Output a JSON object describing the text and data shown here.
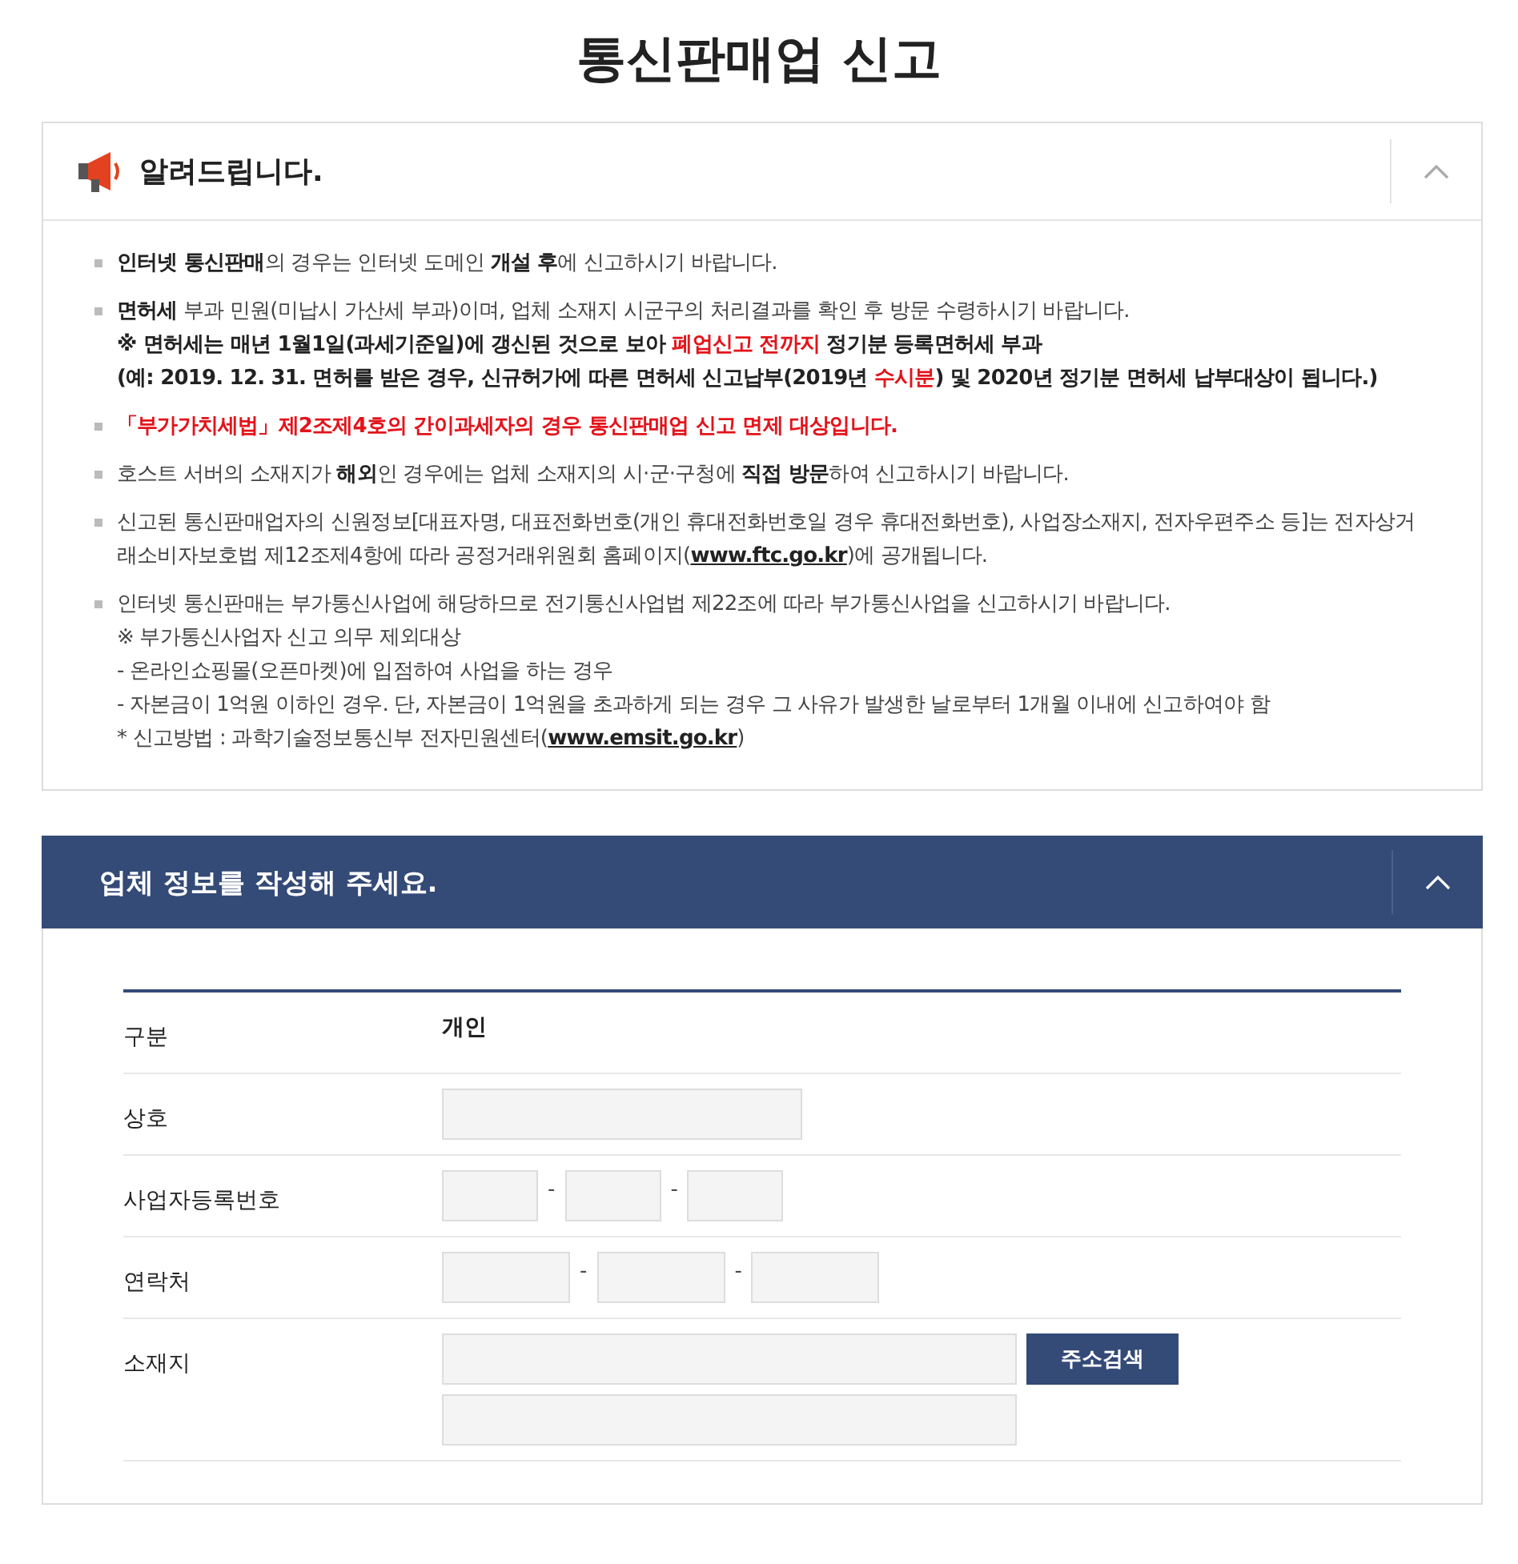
{
  "page_title": "통신판매업 신고",
  "notice": {
    "title": "알려드립니다.",
    "expanded": true,
    "items": [
      {
        "lines": [
          [
            {
              "text": "인터넷 통신판매",
              "kind": "bold"
            },
            {
              "text": "의 경우는 인터넷 도메인 ",
              "kind": "plain"
            },
            {
              "text": "개설 후",
              "kind": "bold"
            },
            {
              "text": "에 신고하시기 바랍니다.",
              "kind": "plain"
            }
          ]
        ]
      },
      {
        "lines": [
          [
            {
              "text": "면허세",
              "kind": "bold"
            },
            {
              "text": " 부과 민원(미납시 가산세 부과)이며, 업체 소재지 시군구의 처리결과를 확인 후 방문 수령하시기 바랍니다.",
              "kind": "plain"
            }
          ],
          [
            {
              "text": "※ 면허세는 매년 1월1일(과세기준일)에 갱신된 것으로 보아 ",
              "kind": "bold"
            },
            {
              "text": "폐업신고 전까지",
              "kind": "red"
            },
            {
              "text": " 정기분 등록면허세 부과",
              "kind": "bold"
            }
          ],
          [
            {
              "text": "(예: 2019. 12. 31. 면허를 받은 경우, 신규허가에 따른 면허세 신고납부(2019년 ",
              "kind": "bold"
            },
            {
              "text": "수시분",
              "kind": "red"
            },
            {
              "text": ") 및 2020년 정기분 면허세 납부대상이 됩니다.)",
              "kind": "bold"
            }
          ]
        ]
      },
      {
        "lines": [
          [
            {
              "text": "「부가가치세법」제2조제4호의 간이과세자의 경우 통신판매업 신고 면제 대상입니다.",
              "kind": "red"
            }
          ]
        ]
      },
      {
        "lines": [
          [
            {
              "text": "호스트 서버의 소재지가 ",
              "kind": "plain"
            },
            {
              "text": "해외",
              "kind": "bold"
            },
            {
              "text": "인 경우에는 업체 소재지의 시·군·구청에 ",
              "kind": "plain"
            },
            {
              "text": "직접 방문",
              "kind": "bold"
            },
            {
              "text": "하여 신고하시기 바랍니다.",
              "kind": "plain"
            }
          ]
        ]
      },
      {
        "lines": [
          [
            {
              "text": "신고된 통신판매업자의 신원정보[대표자명, 대표전화번호(개인 휴대전화번호일 경우 휴대전화번호), 사업장소재지, 전자우편주소 등]는 전자상거래소비자보호법 제12조제4항에 따라 공정거래위원회 홈페이지(",
              "kind": "plain"
            },
            {
              "text": "www.ftc.go.kr",
              "kind": "link"
            },
            {
              "text": ")에 공개됩니다.",
              "kind": "plain"
            }
          ]
        ]
      },
      {
        "lines": [
          [
            {
              "text": "인터넷 통신판매는 부가통신사업에 해당하므로 전기통신사업법 제22조에 따라 부가통신사업을 신고하시기 바랍니다.",
              "kind": "plain"
            }
          ],
          [
            {
              "text": "※ 부가통신사업자 신고 의무 제외대상",
              "kind": "plain"
            }
          ],
          [
            {
              "text": "- 온라인쇼핑몰(오픈마켓)에 입점하여 사업을 하는 경우",
              "kind": "plain"
            }
          ],
          [
            {
              "text": "- 자본금이 1억원 이하인 경우. 단, 자본금이 1억원을 초과하게 되는 경우 그 사유가 발생한 날로부터 1개월 이내에 신고하여야 함",
              "kind": "plain"
            }
          ],
          [
            {
              "text": "* 신고방법 : 과학기술정보통신부 전자민원센터(",
              "kind": "plain"
            },
            {
              "text": "www.emsit.go.kr",
              "kind": "link"
            },
            {
              "text": ")",
              "kind": "plain"
            }
          ]
        ]
      }
    ]
  },
  "form": {
    "title": "업체 정보를 작성해 주세요.",
    "expanded": true,
    "rows": [
      {
        "label": "구분",
        "kind": "value",
        "value": "개인"
      },
      {
        "label": "상호",
        "kind": "single"
      },
      {
        "label": "사업자등록번호",
        "kind": "split-short",
        "separators": [
          "-",
          "-"
        ]
      },
      {
        "label": "연락처",
        "kind": "split-medium",
        "separators": [
          "-",
          "-"
        ]
      },
      {
        "label": "소재지",
        "kind": "address",
        "button": "주소검색"
      }
    ]
  }
}
